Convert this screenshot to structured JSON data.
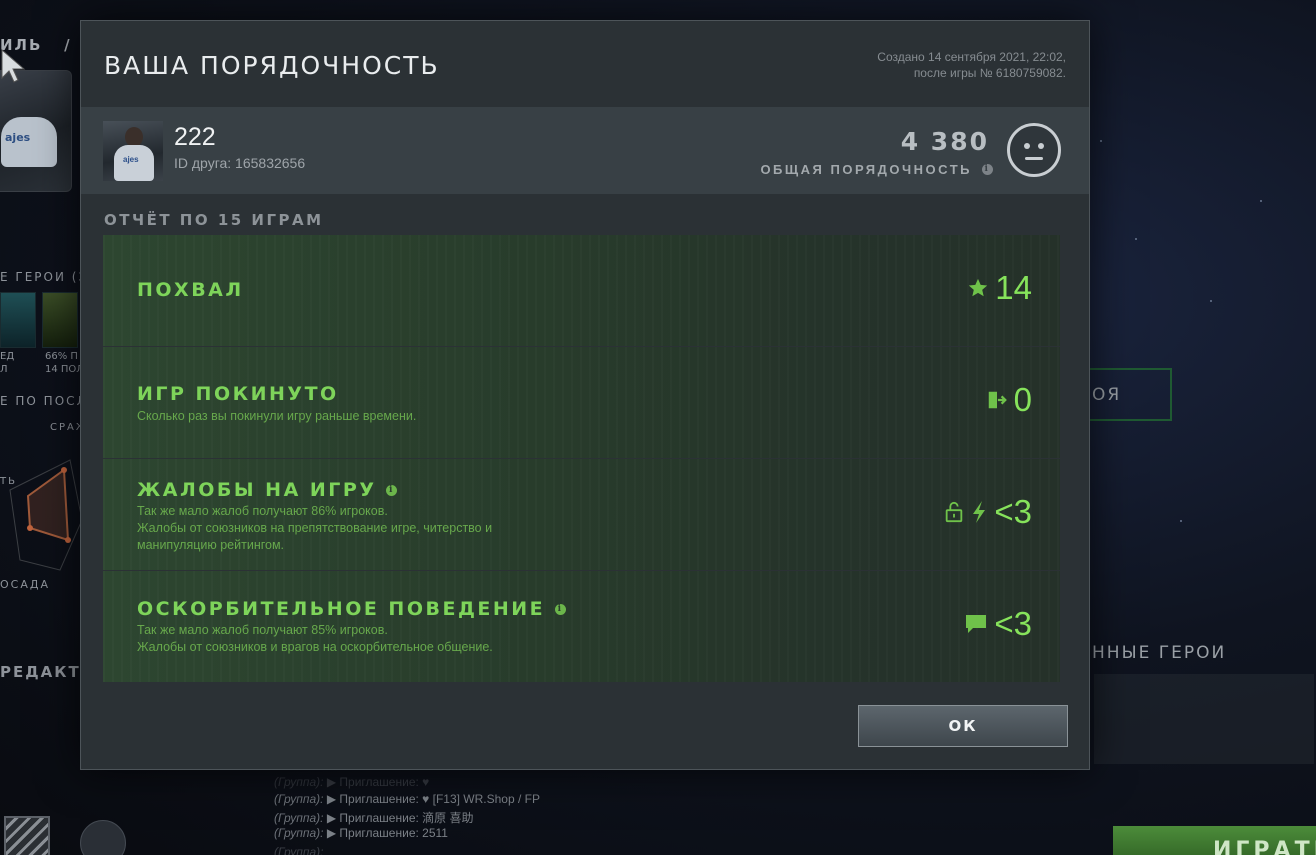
{
  "background": {
    "breadcrumb": "ИЛЬ   /",
    "avatar_logo": "ajes",
    "favorite_heroes_label": "Е ГЕРОИ (ЗА",
    "hero1_stat": "ЕД\nЛ",
    "hero2_stat": "66% П\n14 ПОЛ",
    "after_label": "Е ПО ПОСЛЕ",
    "radar_label1": "СРАЖ",
    "radar_label2": "ТЬ",
    "radar_label3": "ОСАДА",
    "edit_label": "РЕДАКТИР",
    "right_button": "ОЯ",
    "right_heroes": "ННЫЕ ГЕРОИ",
    "play_button": "ИГРАТЬ",
    "chat": [
      {
        "group": "(Группа):",
        "text": "▶ Приглашение: ♥"
      },
      {
        "group": "(Группа):",
        "text": "▶ Приглашение: ♥ [F13] WR.Shop / FP"
      },
      {
        "group": "(Группа):",
        "text": "▶ Приглашение: 滴原 喜助"
      },
      {
        "group": "(Группа):",
        "text": "▶ Приглашение: 2511"
      },
      {
        "group": "(Группа):",
        "text": ""
      }
    ]
  },
  "modal": {
    "title": "ВАША ПОРЯДОЧНОСТЬ",
    "created_line1": "Создано 14 сентября 2021, 22:02,",
    "created_line2": "после игры № 6180759082.",
    "profile": {
      "name": "222",
      "friend_id": "ID друга: 165832656",
      "avatar_logo": "ajes"
    },
    "score": {
      "value": "4 380",
      "label": "ОБЩАЯ ПОРЯДОЧНОСТЬ",
      "face_icon": "neutral-face-icon"
    },
    "report_header": "ОТЧЁТ ПО 15 ИГРАМ",
    "rows": [
      {
        "title": "ПОХВАЛ",
        "description": "",
        "value": "14",
        "icons": [
          "star-icon"
        ]
      },
      {
        "title": "ИГР ПОКИНУТО",
        "description": "Сколько раз вы покинули игру раньше времени.",
        "value": "0",
        "icons": [
          "leave-door-icon"
        ]
      },
      {
        "title": "ЖАЛОБЫ НА ИГРУ",
        "description": "Так же мало жалоб получают 86% игроков.\nЖалобы от союзников на препятствование игре, читерство и\nманипуляцию рейтингом.",
        "value": "<3",
        "icons": [
          "lock-icon",
          "lightning-icon"
        ]
      },
      {
        "title": "ОСКОРБИТЕЛЬНОЕ ПОВЕДЕНИЕ",
        "description": "Так же мало жалоб получают 85% игроков.\nЖалобы от союзников и врагов на оскорбительное общение.",
        "value": "<3",
        "icons": [
          "chat-bubble-icon"
        ]
      }
    ],
    "ok_label": "ОК"
  },
  "colors": {
    "accent_green": "#86e35b",
    "row_green": "#7ed45a",
    "modal_bg": "#2b3135"
  }
}
